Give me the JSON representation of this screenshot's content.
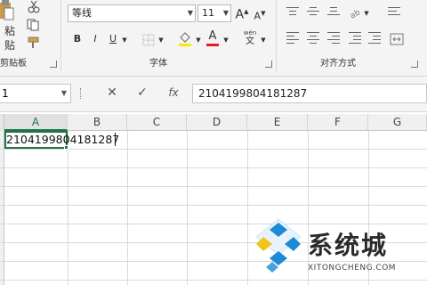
{
  "ribbon": {
    "clipboard": {
      "paste_label": "粘贴",
      "group_label": "剪贴板"
    },
    "font": {
      "font_name": "等线",
      "font_size": "11",
      "grow_label": "A",
      "shrink_label": "A",
      "bold_label": "B",
      "italic_label": "I",
      "underline_label": "U",
      "font_color_label": "A",
      "wen_label": "wén",
      "wen_char": "文",
      "group_label": "字体"
    },
    "alignment": {
      "group_label": "对齐方式"
    }
  },
  "formula_bar": {
    "name_box": "1",
    "cancel_label": "✕",
    "enter_label": "✓",
    "fx_label": "fx",
    "content": "2104199804181287"
  },
  "grid": {
    "columns": [
      "A",
      "B",
      "C",
      "D",
      "E",
      "F",
      "G"
    ],
    "selected_column": "A",
    "active_cell_text": "2104199804181287"
  },
  "watermark": {
    "text": "系统城",
    "url": "XITONGCHENG.COM"
  },
  "colors": {
    "excel_green": "#217346",
    "font_color_red": "#e02020",
    "watermark_blue": "#1e8ad6"
  }
}
